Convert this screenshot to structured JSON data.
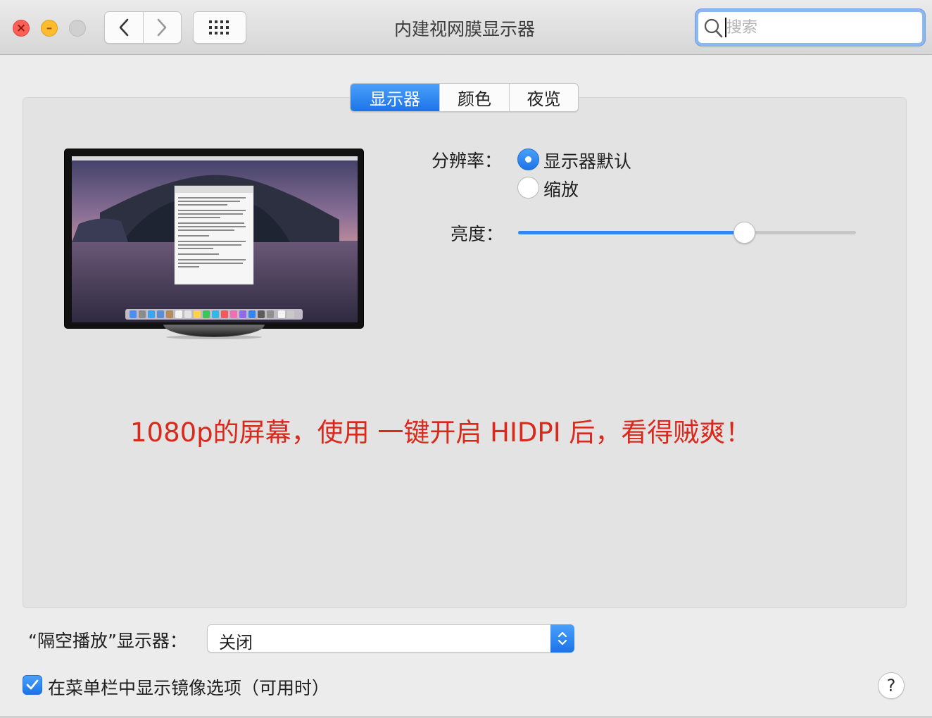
{
  "window": {
    "title": "内建视网膜显示器",
    "search_placeholder": "搜索"
  },
  "tabs": [
    {
      "label": "显示器",
      "active": true
    },
    {
      "label": "颜色",
      "active": false
    },
    {
      "label": "夜览",
      "active": false
    }
  ],
  "display": {
    "resolution_label": "分辨率：",
    "resolution_options": [
      {
        "label": "显示器默认",
        "selected": true
      },
      {
        "label": "缩放",
        "selected": false
      }
    ],
    "brightness_label": "亮度：",
    "brightness_level": 0.67
  },
  "annotation": {
    "text": "1080p的屏幕，使用 一键开启 HIDPI 后，看得贼爽！",
    "color": "#d9291c"
  },
  "airplay": {
    "label": "“隔空播放”显示器：",
    "value": "关闭"
  },
  "mirror_option": {
    "label": "在菜单栏中显示镜像选项（可用时）",
    "checked": true
  },
  "help_label": "?",
  "colors": {
    "accent": "#2f86f4",
    "close": "#fc5f57",
    "minimize": "#fdbc2e"
  },
  "icons": {
    "close": "close-icon",
    "minimize": "minimize-icon",
    "back": "chevron-left-icon",
    "forward": "chevron-right-icon",
    "grid": "grid-icon",
    "search": "search-icon",
    "stepper": "chevron-up-down-icon",
    "checkbox": "checkmark-icon",
    "help": "question-icon"
  }
}
